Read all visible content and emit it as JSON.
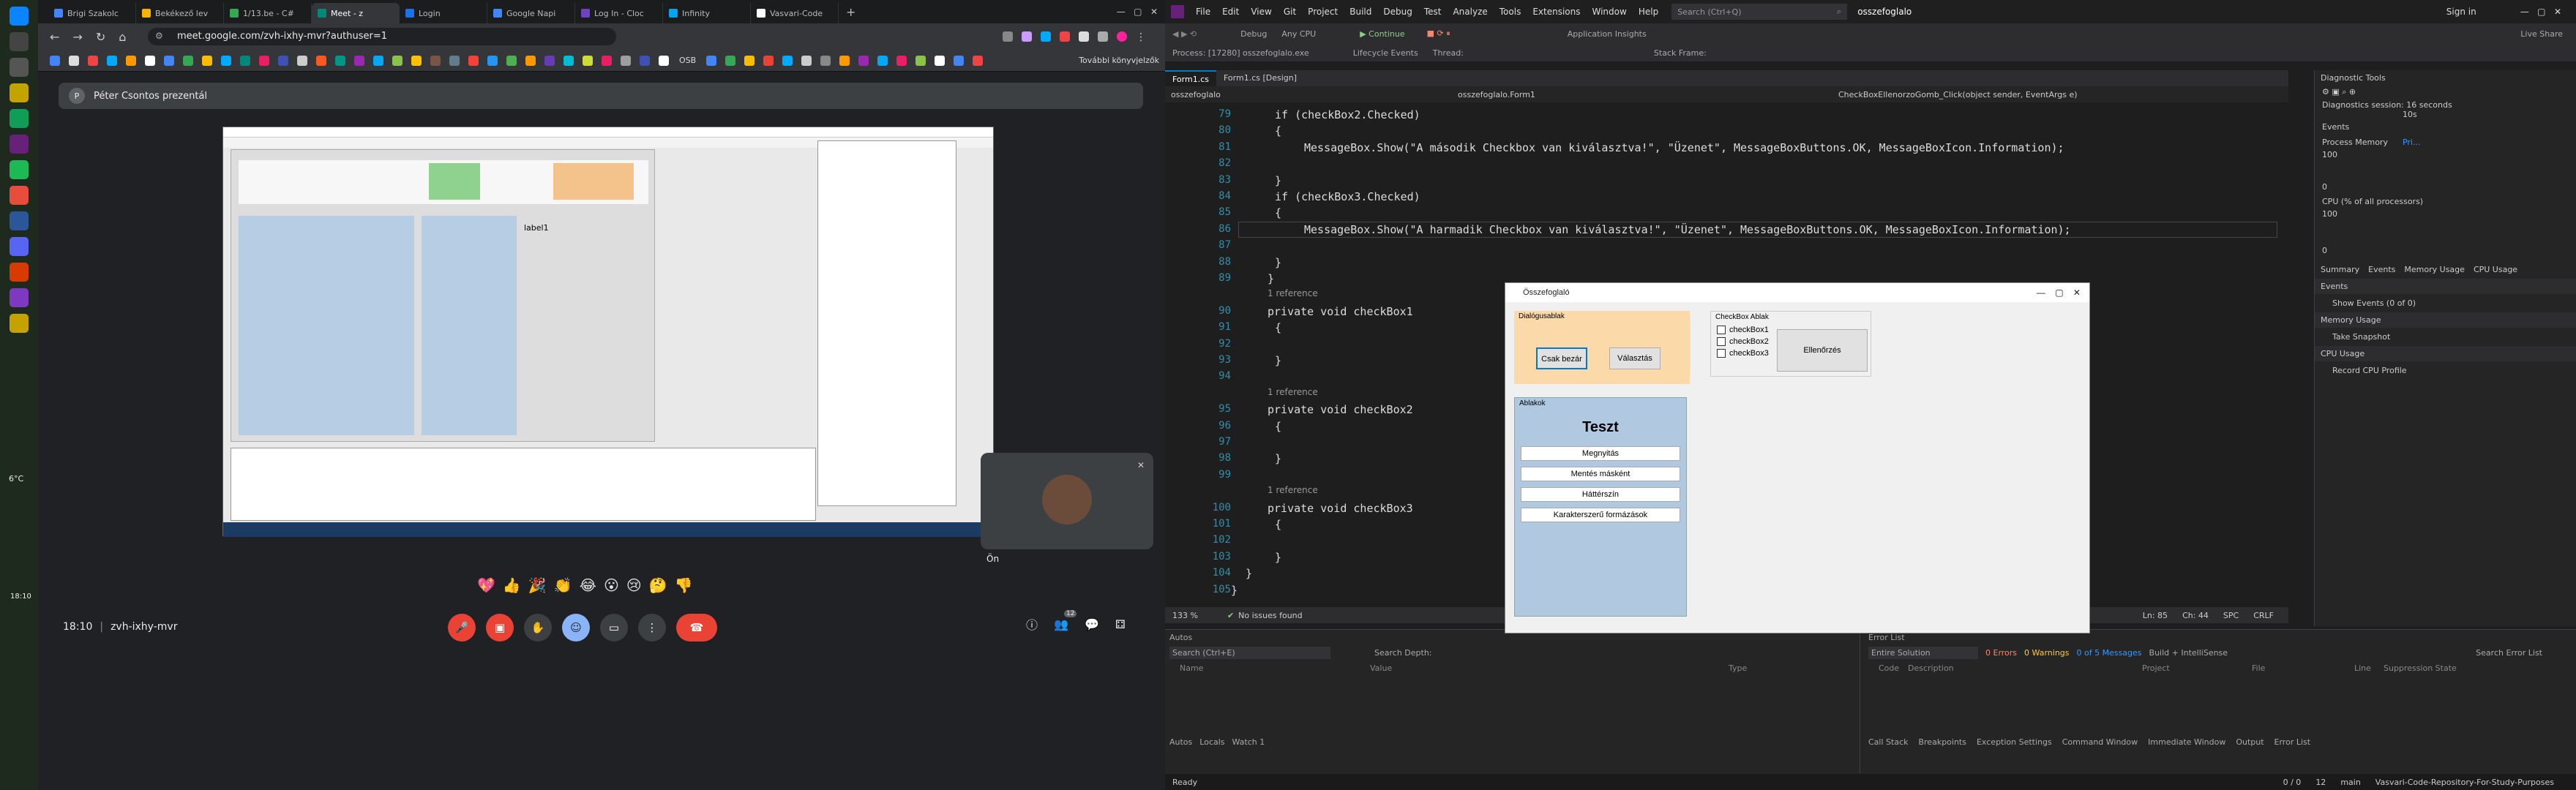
{
  "browser": {
    "tabs": [
      {
        "label": "Brigi Szakolc",
        "color": "#4285f4"
      },
      {
        "label": "Bekékező lev",
        "color": "#f4b400"
      },
      {
        "label": "1/13.be - C#",
        "color": "#34a853"
      },
      {
        "label": "Meet - z",
        "color": "#00897b"
      },
      {
        "label": "Login",
        "color": "#1a73e8"
      },
      {
        "label": "Google Napi",
        "color": "#4285f4"
      },
      {
        "label": "Log In - Cloc",
        "color": "#6f42c1"
      },
      {
        "label": "Infinity",
        "color": "#00a4ef"
      },
      {
        "label": "Vasvari-Code",
        "color": "#ffffff"
      }
    ],
    "url": "meet.google.com/zvh-ixhy-mvr?authuser=1",
    "bookmark_folder": "További könyvjelzők",
    "bookmark_osb": "OSB"
  },
  "meet": {
    "presenter": "Péter Csontos prezentál",
    "self_label": "Ön",
    "time": "18:10",
    "meeting_code": "zvh-ixhy-mvr",
    "participants_badge": "12",
    "reactions": [
      "💖",
      "👍",
      "🎉",
      "👏",
      "😂",
      "😮",
      "😢",
      "🤔",
      "👎"
    ]
  },
  "taskbar": {
    "weather": "6°C",
    "clock": "18:10"
  },
  "vs": {
    "menu": [
      "File",
      "Edit",
      "View",
      "Git",
      "Project",
      "Build",
      "Debug",
      "Test",
      "Analyze",
      "Tools",
      "Extensions",
      "Window",
      "Help"
    ],
    "search": "Search (Ctrl+Q)",
    "solution": "osszefoglalo",
    "signin": "Sign in",
    "live_share": "Live Share",
    "toolbar": {
      "continue": "Continue",
      "insights": "Application Insights",
      "debug": "Debug",
      "cpu": "Any CPU"
    },
    "process": "Process: [17280] osszefoglalo.exe",
    "lifecycle": "Lifecycle Events",
    "thread": "Thread:",
    "stackframe": "Stack Frame:",
    "doc_tabs": [
      "Form1.cs",
      "Form1.cs [Design]"
    ],
    "nav": {
      "project": "osszefoglalo",
      "class": "osszefoglalo.Form1",
      "method": "CheckBoxEllenorzoGomb_Click(object sender, EventArgs e)"
    },
    "code": [
      {
        "n": "79",
        "t": "if (checkBox2.Checked)"
      },
      {
        "n": "80",
        "t": "{"
      },
      {
        "n": "81",
        "t": "MessageBox.Show(\"A második Checkbox van kiválasztva!\", \"Üzenet\", MessageBoxButtons.OK, MessageBoxIcon.Information);"
      },
      {
        "n": "82",
        "t": ""
      },
      {
        "n": "83",
        "t": "}"
      },
      {
        "n": "84",
        "t": "if (checkBox3.Checked)"
      },
      {
        "n": "85",
        "t": "{"
      },
      {
        "n": "86",
        "t": "MessageBox.Show(\"A harmadik Checkbox van kiválasztva!\", \"Üzenet\", MessageBoxButtons.OK, MessageBoxIcon.Information);"
      },
      {
        "n": "87",
        "t": ""
      },
      {
        "n": "88",
        "t": "}"
      },
      {
        "n": "89",
        "t": "}"
      },
      {
        "n": "",
        "t": "1 reference"
      },
      {
        "n": "90",
        "t": "private void checkBox1"
      },
      {
        "n": "91",
        "t": "{"
      },
      {
        "n": "92",
        "t": ""
      },
      {
        "n": "93",
        "t": "}"
      },
      {
        "n": "94",
        "t": ""
      },
      {
        "n": "",
        "t": "1 reference"
      },
      {
        "n": "95",
        "t": "private void checkBox2"
      },
      {
        "n": "96",
        "t": "{"
      },
      {
        "n": "97",
        "t": ""
      },
      {
        "n": "98",
        "t": "}"
      },
      {
        "n": "99",
        "t": ""
      },
      {
        "n": "",
        "t": "1 reference"
      },
      {
        "n": "100",
        "t": "private void checkBox3"
      },
      {
        "n": "101",
        "t": "{"
      },
      {
        "n": "102",
        "t": ""
      },
      {
        "n": "103",
        "t": "}"
      },
      {
        "n": "104",
        "t": "}"
      },
      {
        "n": "105",
        "t": "}"
      }
    ],
    "editor_status": {
      "zoom": "133 %",
      "issues": "No issues found",
      "ln": "Ln: 85",
      "ch": "Ch: 44",
      "spc": "SPC",
      "crlf": "CRLF"
    },
    "diag": {
      "title": "Diagnostic Tools",
      "session": "Diagnostics session: 16 seconds",
      "tick": "10s",
      "events": "Events",
      "proc_mem": "Process Memory",
      "pri": "Pri...",
      "m100": "100",
      "m0": "0",
      "cpu": "CPU (% of all processors)",
      "tabs": [
        "Summary",
        "Events",
        "Memory Usage",
        "CPU Usage"
      ],
      "events_h": "Events",
      "show_events": "Show Events (0 of 0)",
      "mem_h": "Memory Usage",
      "snapshot": "Take Snapshot",
      "cpu_h": "CPU Usage",
      "record": "Record CPU Profile"
    },
    "autos": {
      "title": "Autos",
      "search": "Search (Ctrl+E)",
      "depth": "Search Depth:",
      "cols": [
        "Name",
        "Value",
        "Type"
      ],
      "tabs": [
        "Autos",
        "Locals",
        "Watch 1"
      ]
    },
    "errors": {
      "title": "Error List",
      "scope": "Entire Solution",
      "errors": "0 Errors",
      "warnings": "0 Warnings",
      "messages": "0 of 5 Messages",
      "build": "Build + IntelliSense",
      "search": "Search Error List",
      "cols": [
        "Code",
        "Description",
        "Project",
        "File",
        "Line",
        "Suppression State"
      ],
      "tabs": [
        "Call Stack",
        "Breakpoints",
        "Exception Settings",
        "Command Window",
        "Immediate Window",
        "Output",
        "Error List"
      ]
    },
    "status": {
      "ready": "Ready",
      "pos": "0 / 0",
      "branch_count": "12",
      "branch": "main",
      "repo": "Vasvari-Code-Repository-For-Study-Purposes"
    }
  },
  "winform": {
    "title": "Összefoglaló",
    "dialog_group": "Dialógusablak",
    "btn_close": "Csak bezár",
    "btn_choice": "Választás",
    "checkbox_group": "CheckBox Ablak",
    "checks": [
      "checkBox1",
      "checkBox2",
      "checkBox3"
    ],
    "btn_check": "Ellenőrzés",
    "windows_group": "Ablakok",
    "heading": "Teszt",
    "buttons": [
      "Megnyitás",
      "Mentés másként",
      "Háttérszín",
      "Karakterszerű formázások"
    ]
  },
  "shared": {
    "label1": "label1"
  }
}
